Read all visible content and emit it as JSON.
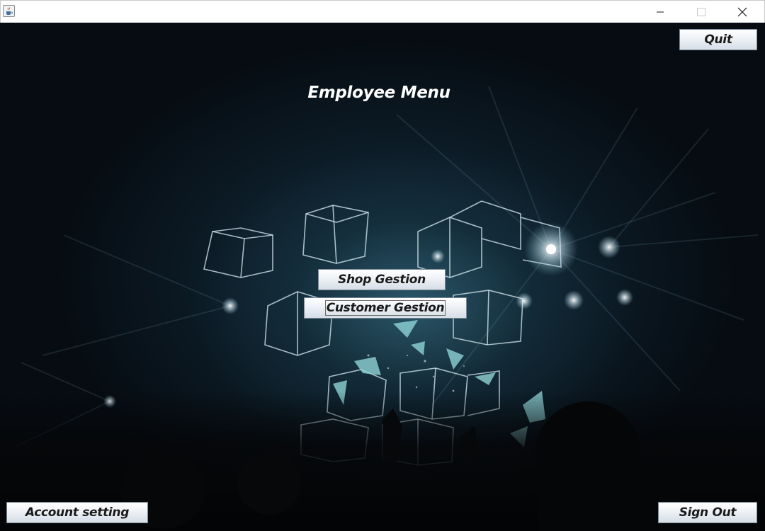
{
  "window": {
    "title": ""
  },
  "page": {
    "title": "Employee Menu"
  },
  "buttons": {
    "quit": "Quit",
    "shop_gestion": "Shop Gestion",
    "customer_gestion": "Customer Gestion",
    "account_setting": "Account setting",
    "sign_out": "Sign Out"
  },
  "icons": {
    "app": "java-coffee-icon",
    "minimize": "minimize-icon",
    "maximize": "maximize-icon",
    "close": "close-icon",
    "background": "concert-light-cubes-image"
  },
  "colors": {
    "background_dark": "#05090e",
    "glow": "#3c788c",
    "title_text": "#ffffff",
    "button_text": "#1a1a1a"
  }
}
